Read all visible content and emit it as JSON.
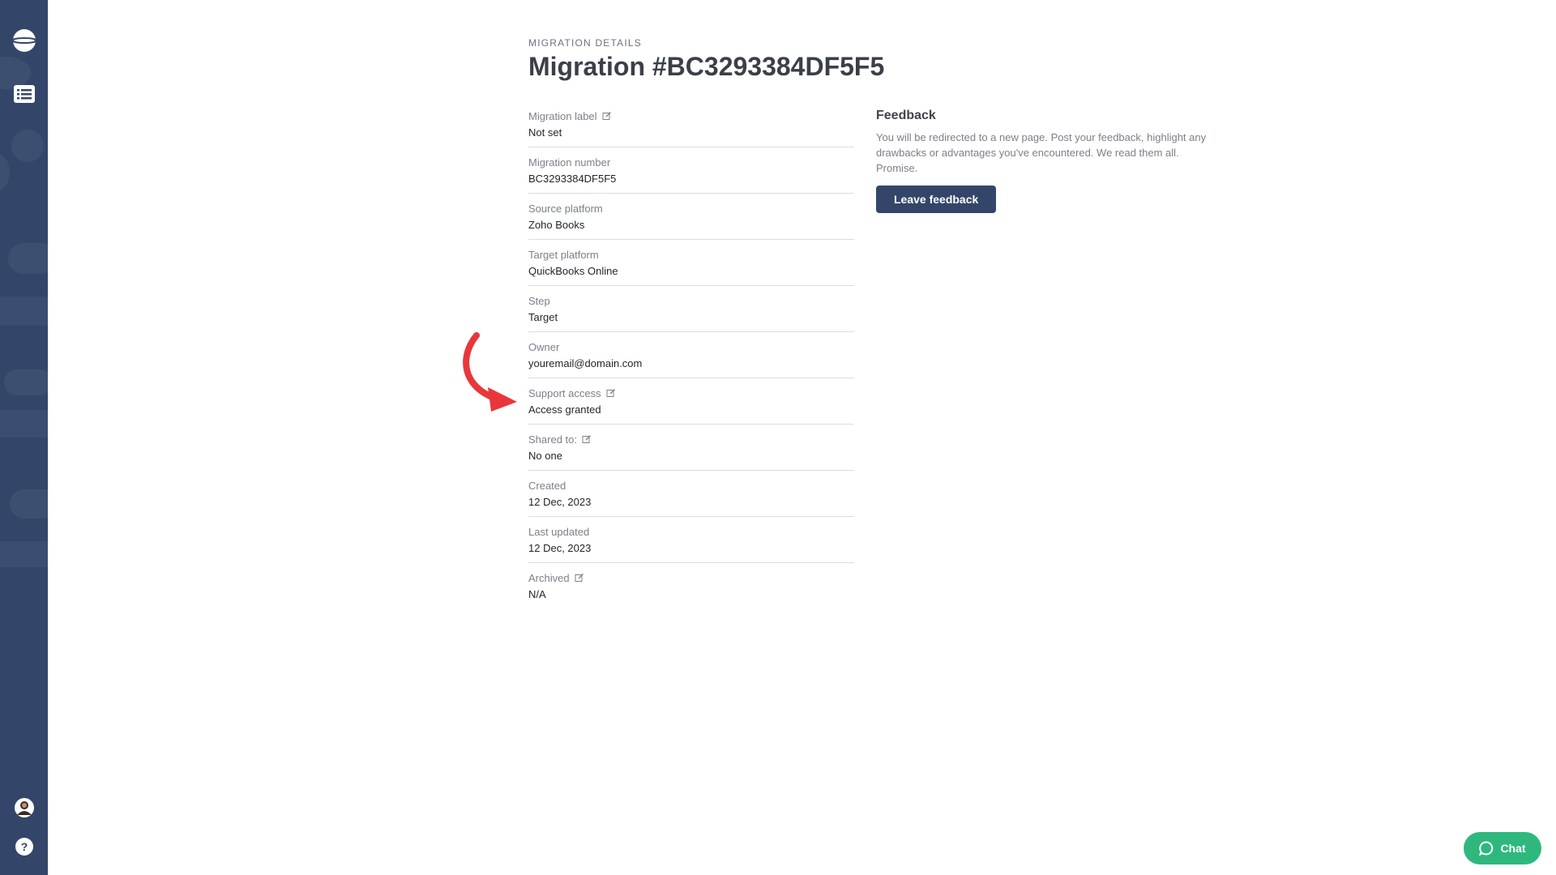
{
  "sidebar": {
    "logo_icon": "planet-logo-icon",
    "nav_icon": "list-icon",
    "avatar_icon": "avatar",
    "help_icon": "help-icon"
  },
  "page": {
    "eyebrow": "MIGRATION DETAILS",
    "title": "Migration #BC3293384DF5F5"
  },
  "details": [
    {
      "label": "Migration label",
      "value": "Not set",
      "editable": true
    },
    {
      "label": "Migration number",
      "value": "BC3293384DF5F5",
      "editable": false
    },
    {
      "label": "Source platform",
      "value": "Zoho Books",
      "editable": false
    },
    {
      "label": "Target platform",
      "value": "QuickBooks Online",
      "editable": false
    },
    {
      "label": "Step",
      "value": "Target",
      "editable": false
    },
    {
      "label": "Owner",
      "value": "youremail@domain.com",
      "editable": false
    },
    {
      "label": "Support access",
      "value": "Access granted",
      "editable": true
    },
    {
      "label": "Shared to:",
      "value": "No one",
      "editable": true
    },
    {
      "label": "Created",
      "value": "12 Dec, 2023",
      "editable": false
    },
    {
      "label": "Last updated",
      "value": "12 Dec, 2023",
      "editable": false
    },
    {
      "label": "Archived",
      "value": "N/A",
      "editable": true
    }
  ],
  "feedback": {
    "title": "Feedback",
    "text": "You will be redirected to a new page. Post your feedback, highlight any drawbacks or advantages you've encountered. We read them all. Promise.",
    "button_label": "Leave feedback"
  },
  "chat": {
    "label": "Chat",
    "color": "#2eb87e"
  },
  "colors": {
    "sidebar": "#33466a",
    "button": "#33466a",
    "annotation_arrow": "#e8373a"
  }
}
